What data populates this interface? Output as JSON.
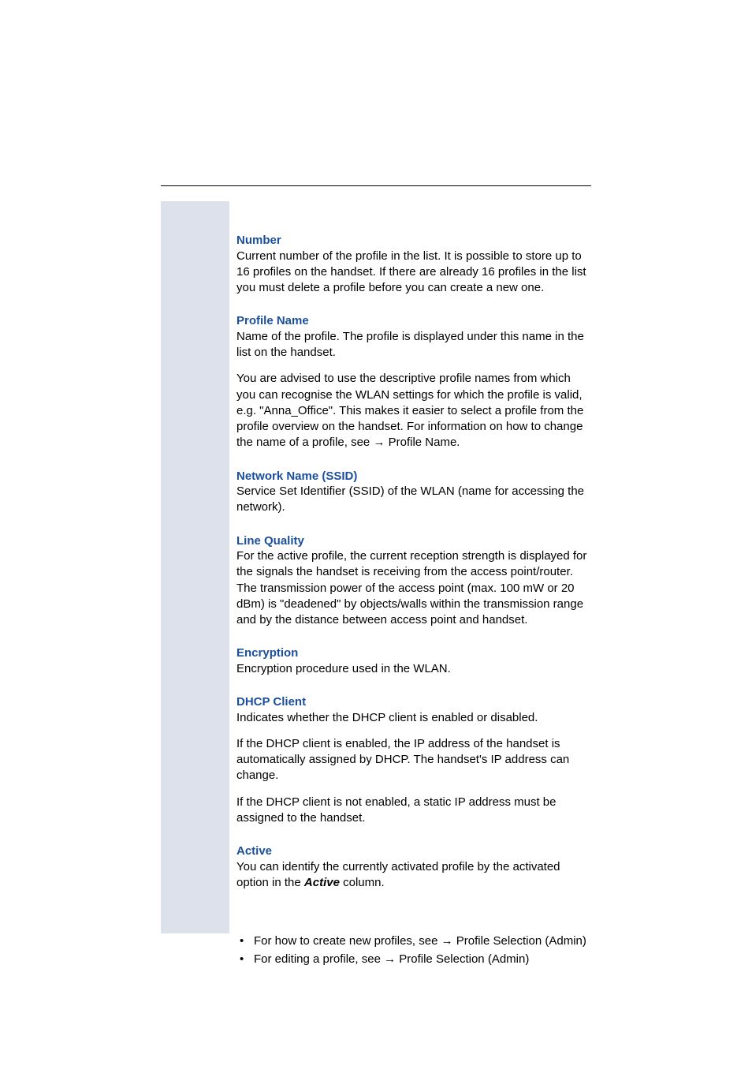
{
  "sections": {
    "number": {
      "title": "Number",
      "body": "Current number of the profile in the list. It is possible to store up to 16 profiles on the handset. If there are already 16 profiles in the list you must delete a profile before you can create a new one."
    },
    "profileName": {
      "title": "Profile Name",
      "body1": "Name of the profile. The profile is displayed under this name in the list on the handset.",
      "body2a": "You are advised to use the descriptive profile names from which you can recognise the WLAN settings for which the profile is valid, e.g. \"Anna_Office\". This makes it easier to select a profile from the profile overview on the handset. For information on how to change the name of a profile, see ",
      "arrow": "→",
      "body2b": " Profile Name."
    },
    "ssid": {
      "title": "Network Name (SSID)",
      "body": "Service Set Identifier (SSID) of the WLAN (name for accessing the network)."
    },
    "lineQuality": {
      "title": "Line Quality",
      "body": "For the active profile, the current reception strength is displayed for the signals the handset is receiving from the access point/router. The transmission power of the access point (max. 100 mW or 20 dBm) is \"deadened\" by objects/walls within the transmission range and by the distance between access point and handset."
    },
    "encryption": {
      "title": "Encryption",
      "body": "Encryption procedure used in the WLAN."
    },
    "dhcp": {
      "title": "DHCP Client",
      "body1": "Indicates whether the DHCP client is enabled or disabled.",
      "body2": "If the DHCP client is enabled, the IP address of the handset is automatically assigned by DHCP. The handset's IP address can change.",
      "body3": "If the DHCP client is not enabled, a static IP address must be assigned to the handset."
    },
    "active": {
      "title": "Active",
      "body_a": "You can identify the currently activated profile by the activated option in the ",
      "body_bold": "Active",
      "body_b": " column."
    },
    "bullets": {
      "item1_a": "For how to create new profiles, see ",
      "item1_arrow": "→",
      "item1_b": " Profile Selection (Admin)",
      "item2_a": "For editing a profile, see ",
      "item2_arrow": "→",
      "item2_b": " Profile Selection (Admin)"
    }
  }
}
